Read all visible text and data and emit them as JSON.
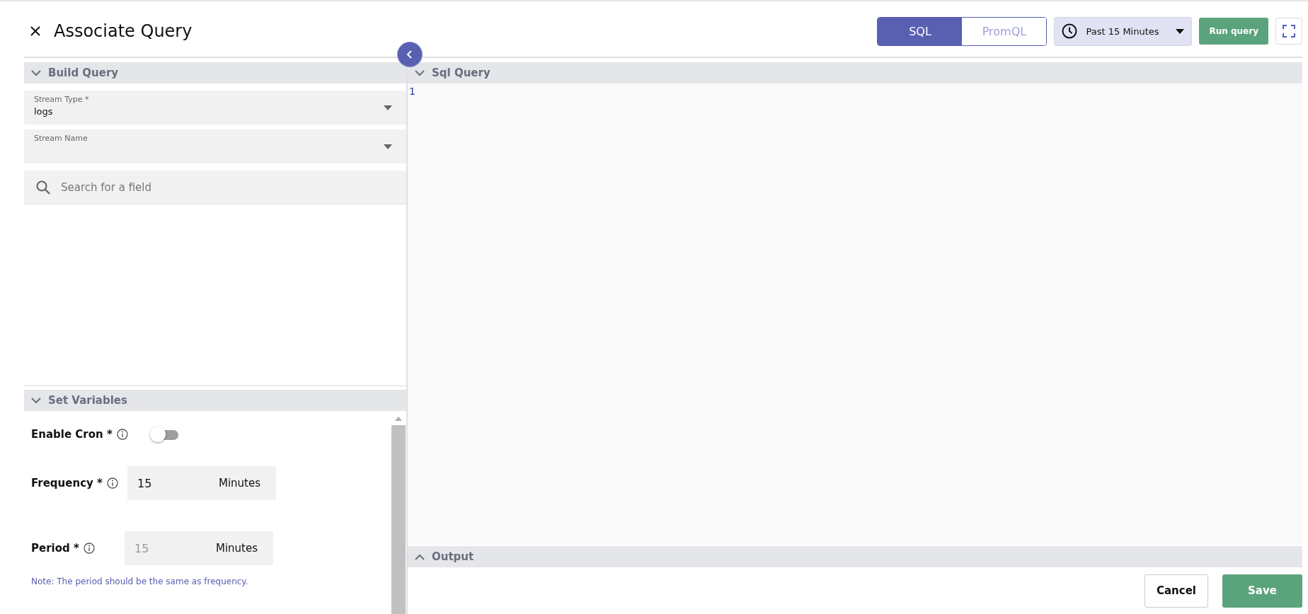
{
  "title": "Associate Query",
  "query_types": [
    {
      "label": "SQL",
      "selected": true
    },
    {
      "label": "PromQL",
      "selected": false
    }
  ],
  "time_range": "Past 15 Minutes",
  "run_button": "Run query",
  "build_query": {
    "title": "Build Query",
    "expanded": true,
    "fields": [
      {
        "label": "Stream Type *",
        "value": "logs"
      },
      {
        "label": "Stream Name"
      }
    ],
    "search": {
      "placeholder": "Search for a field"
    }
  },
  "set_variables": {
    "title": "Set Variables",
    "expanded": true,
    "enable_cron": {
      "label": "Enable Cron *",
      "on": false
    },
    "frequency": {
      "label": "Frequency *",
      "value": "15",
      "unit": "Minutes",
      "disabled": false
    },
    "period": {
      "label": "Period *",
      "value": "15",
      "unit": "Minutes",
      "disabled": true
    },
    "note": "Note: The period should be the same as frequency."
  },
  "sql_query": {
    "title": "Sql Query",
    "expanded": true,
    "line_numbers": [
      "1"
    ]
  },
  "output": {
    "title": "Output",
    "expanded": false
  },
  "buttons": {
    "cancel": "Cancel",
    "save": "Save"
  }
}
